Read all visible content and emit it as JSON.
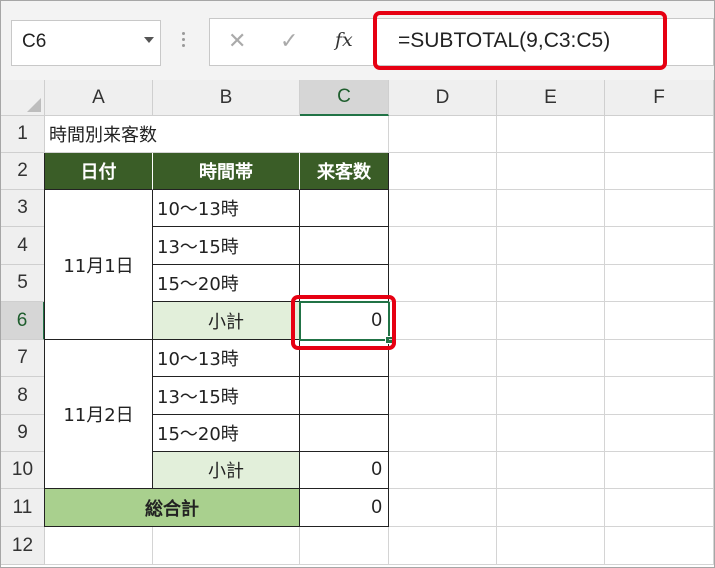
{
  "namebox": "C6",
  "formula_bar": {
    "cancel_icon": "cancel-icon",
    "enter_icon": "enter-icon",
    "fx_label": "fx",
    "formula": "=SUBTOTAL(9,C3:C5)"
  },
  "columns": [
    "A",
    "B",
    "C",
    "D",
    "E",
    "F"
  ],
  "rows": [
    "1",
    "2",
    "3",
    "4",
    "5",
    "6",
    "7",
    "8",
    "9",
    "10",
    "11",
    "12"
  ],
  "cells": {
    "A1": "時間別来客数",
    "A2": "日付",
    "B2": "時間帯",
    "C2": "来客数",
    "A3": "11月1日",
    "B3": "10〜13時",
    "B4": "13〜15時",
    "B5": "15〜20時",
    "B6": "小計",
    "C6": "0",
    "A7": "11月2日",
    "B7": "10〜13時",
    "B8": "13〜15時",
    "B9": "15〜20時",
    "B10": "小計",
    "C10": "0",
    "A11": "総合計",
    "C11": "0"
  },
  "colors": {
    "header_dark_green": "#3a5d27",
    "subtotal_light_green": "#e2efda",
    "total_green": "#a9d08e",
    "highlight_red": "#e60012",
    "selection_green": "#217346"
  }
}
